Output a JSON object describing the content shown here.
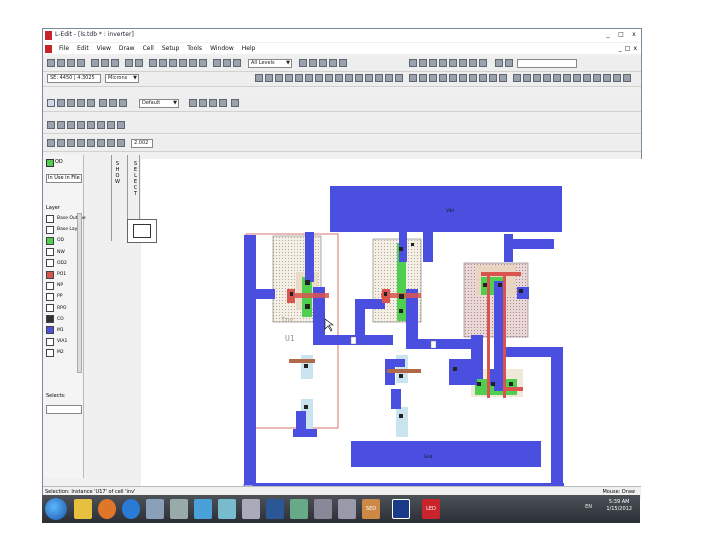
{
  "window": {
    "title": "L-Edit - [ls.tdb * : inverter]",
    "controls": [
      "_",
      "□",
      "x"
    ]
  },
  "menu": [
    "File",
    "Edit",
    "View",
    "Draw",
    "Cell",
    "Setup",
    "Tools",
    "Window",
    "Help"
  ],
  "mdi_controls": [
    "_",
    "□",
    "x"
  ],
  "toolbar": {
    "layer_combo": "All Levels",
    "coords": "SE: 4450 | 4.3025",
    "units": "Microns",
    "style": "Default",
    "wire_width": "2.002"
  },
  "left_panel": {
    "current_layer": "OD",
    "filter": "In Use in File",
    "layer_header": "Layer",
    "layers": [
      {
        "name": "Base Outline",
        "color": "#ffffff"
      },
      {
        "name": "Base Layer",
        "color": "#ffffff"
      },
      {
        "name": "OD",
        "color": "#4fce4f"
      },
      {
        "name": "NW",
        "color": "#ffffff"
      },
      {
        "name": "OD2",
        "color": "#ffffff"
      },
      {
        "name": "PO1",
        "color": "#d9534f"
      },
      {
        "name": "NP",
        "color": "#ffffff"
      },
      {
        "name": "PP",
        "color": "#ffffff"
      },
      {
        "name": "RPO",
        "color": "#ffffff"
      },
      {
        "name": "CO",
        "color": "#333333"
      },
      {
        "name": "M1",
        "color": "#4a4fe0"
      },
      {
        "name": "VIA1",
        "color": "#ffffff"
      },
      {
        "name": "M2",
        "color": "#ffffff"
      }
    ],
    "selects_label": "Selects:",
    "vertical_labels": [
      "SHOW",
      "SELECT"
    ]
  },
  "layout": {
    "vdd_label": "Vdd",
    "gnd_label": "Gnd",
    "instance_text_1": "Inv",
    "instance_text_2": "U1"
  },
  "status": {
    "left": "Selection: Instance 'U17' of cell 'inv'",
    "right": "Mouse: Draw"
  },
  "taskbar": {
    "time": "5:39 AM",
    "date": "1/15/2012",
    "lang": "EN",
    "apps": [
      "SED",
      "LED"
    ]
  }
}
